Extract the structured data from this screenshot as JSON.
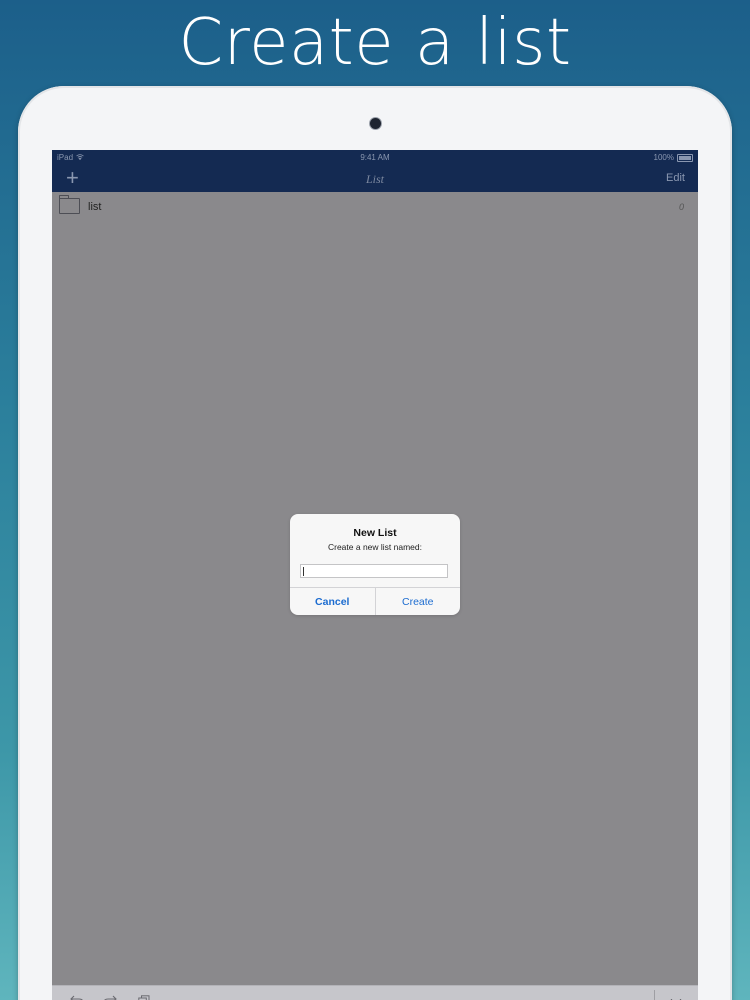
{
  "headline": "Create a list",
  "status_bar": {
    "carrier": "iPad",
    "time": "9:41 AM",
    "battery": "100%"
  },
  "nav_bar": {
    "add_label": "+",
    "title": "List",
    "edit_label": "Edit"
  },
  "list": {
    "items": [
      {
        "label": "list",
        "count": "0"
      }
    ]
  },
  "dialog": {
    "title": "New List",
    "message": "Create a new list named:",
    "input_value": "",
    "cancel_label": "Cancel",
    "create_label": "Create"
  },
  "toolbar": {
    "undo_icon": "undo-arrow",
    "redo_icon": "redo-arrow",
    "copy_icon": "copy-pages",
    "collapse_icon": "chevron-down"
  },
  "colors": {
    "nav_background": "#142a52",
    "dialog_button": "#1c6cd0",
    "dim_overlay": "#8a898c"
  }
}
